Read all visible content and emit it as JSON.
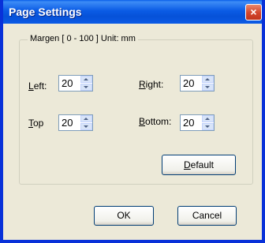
{
  "window": {
    "title": "Page Settings",
    "close_glyph": "×"
  },
  "group": {
    "legend": "Margen [ 0 - 100 ]  Unit: mm"
  },
  "fields": {
    "left": {
      "label_accel": "L",
      "label_rest": "eft:",
      "value": "20"
    },
    "right": {
      "label_accel": "R",
      "label_rest": "ight:",
      "value": "20"
    },
    "top": {
      "label_accel": "T",
      "label_rest": "op",
      "value": "20"
    },
    "bottom": {
      "label_accel": "B",
      "label_rest": "ottom:",
      "value": "20"
    }
  },
  "buttons": {
    "default": {
      "accel": "D",
      "rest": "efault"
    },
    "ok": "OK",
    "cancel": "Cancel"
  }
}
